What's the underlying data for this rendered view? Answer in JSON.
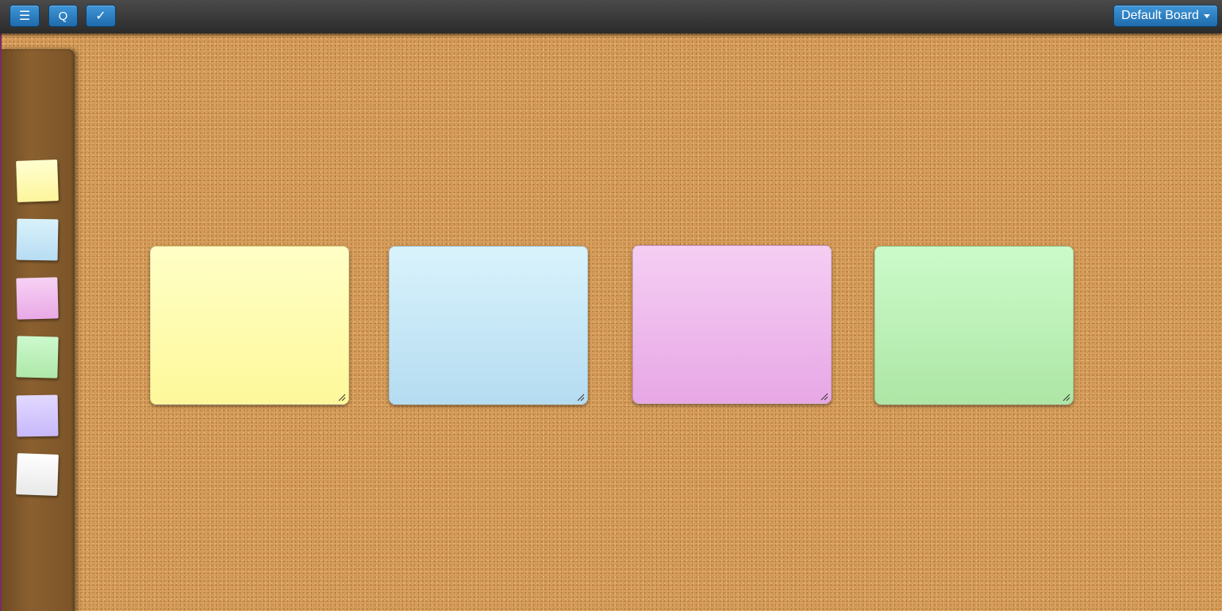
{
  "toolbar": {
    "menu_icon": "hamburger-menu-icon",
    "menu_glyph": "☰",
    "refresh_icon": "refresh-icon",
    "refresh_glyph": "Q",
    "check_icon": "checkmark-icon",
    "check_glyph": "✓",
    "board_label": "Default Board",
    "button_color": "#2a7fc4"
  },
  "palette": {
    "swatches": [
      {
        "name": "yellow",
        "color_top": "#ffffd0",
        "color_bottom": "#fdf59c"
      },
      {
        "name": "blue",
        "color_top": "#d9f2fb",
        "color_bottom": "#b7dcf2"
      },
      {
        "name": "pink",
        "color_top": "#f7d1f4",
        "color_bottom": "#e9a9e6"
      },
      {
        "name": "green",
        "color_top": "#ccf9cd",
        "color_bottom": "#aee8a9"
      },
      {
        "name": "purple",
        "color_top": "#e2d9ff",
        "color_bottom": "#c8b8fb"
      },
      {
        "name": "white",
        "color_top": "#ffffff",
        "color_bottom": "#e8e8e8"
      }
    ]
  },
  "notes": [
    {
      "color_name": "yellow",
      "color_top": "#ffffc6",
      "color_bottom": "#fdf89a",
      "text": ""
    },
    {
      "color_name": "blue",
      "color_top": "#d9f3fc",
      "color_bottom": "#b5dcf1",
      "text": ""
    },
    {
      "color_name": "pink",
      "color_top": "#f5cef3",
      "color_bottom": "#e7a7e5",
      "text": ""
    },
    {
      "color_name": "green",
      "color_top": "#cbfbca",
      "color_bottom": "#ade6a5",
      "text": ""
    }
  ],
  "colors": {
    "cork": "#dda460",
    "toolbar": "#333333"
  }
}
